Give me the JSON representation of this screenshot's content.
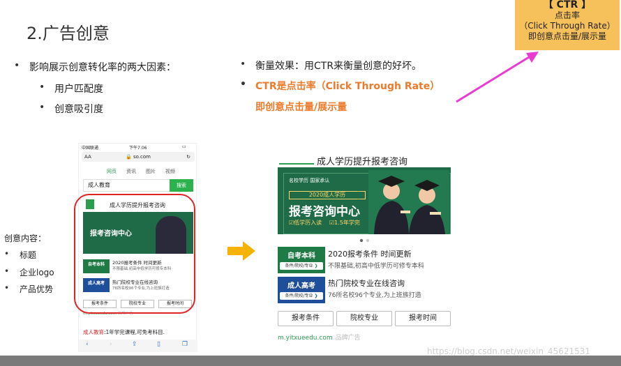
{
  "slide": {
    "title": "2.广告创意",
    "bullets_left": [
      "影响展示创意转化率的两大因素：",
      "用户匹配度",
      "创意吸引度"
    ],
    "bullets_right": [
      "衡量效果：用CTR来衡量创意的好坏。",
      "CTR是点击率（Click Through Rate）",
      "即创意点击量/展示量"
    ],
    "creative_label": "创意内容：",
    "creative_items": [
      "标题",
      "企业logo",
      "产品优势"
    ]
  },
  "callout": {
    "line1": "【 CTR 】",
    "line2": "点击率",
    "line3": "（Click Through Rate）",
    "line4": "即创意点击量/展示量"
  },
  "phone": {
    "status_carrier": "中国联通",
    "status_time": "下午7:06",
    "url_aa": "AA",
    "url": "so.com",
    "tabs": [
      "网页",
      "资讯",
      "图片",
      "视频"
    ],
    "search_value": "成人教育",
    "search_button": "搜索",
    "ad_title": "成人学历提升报考咨询",
    "cat1": "自考本科",
    "cat1_sub": "条件/院校/专业",
    "item1_head": "2020报考条件 时间更新",
    "item1_desc": "不限基础,初高中低学历可修专本科",
    "cat2": "成人高考",
    "cat2_sub": "条件/院校/专业",
    "item2_head": "热门院校专业在线咨询",
    "item2_desc": "76所名校96个专业,为上班族打造",
    "buttons": [
      "报考条件",
      "院校专业",
      "报考时间"
    ],
    "footer_url": "m.yitxueedu.com",
    "footer_brand": "品牌广告",
    "result_text": "成人教育",
    "result_rest": ":1年学完课程,可免考科目."
  },
  "ad": {
    "title": "成人学历提升报考咨询",
    "banner_top_left": "名校学历 国家承认",
    "banner_year": "2020成人学历",
    "banner_main": "报考咨询中心",
    "banner_tag1": "低学历入读",
    "banner_tag2": "1.5年学完",
    "cat1": "自考本科",
    "cat1_sub": "条件/院校/专业",
    "item1_head": "2020报考条件 时间更新",
    "item1_desc": "不限基础,初高中低学历可修专本科",
    "cat2": "成人高考",
    "cat2_sub": "条件/院校/专业",
    "item2_head": "热门院校专业在线咨询",
    "item2_desc": "76所名校96个专业,为上班族打造",
    "buttons": [
      "报考条件",
      "院校专业",
      "报考时间"
    ],
    "footer_url": "m.yitxueedu.com",
    "footer_brand": "品牌广告"
  },
  "watermark": "https://blog.csdn.net/weixin_45621531",
  "colors": {
    "accent_green": "#1f6b47",
    "cat1_green": "#1f7a45",
    "cat2_blue": "#1f4e9a",
    "callout_bg": "#f6c15a",
    "oval_red": "#e02424",
    "arrow_yellow": "#f6b400",
    "arrow_pink": "#e93ad3",
    "orange_text": "#ee7a2b"
  }
}
